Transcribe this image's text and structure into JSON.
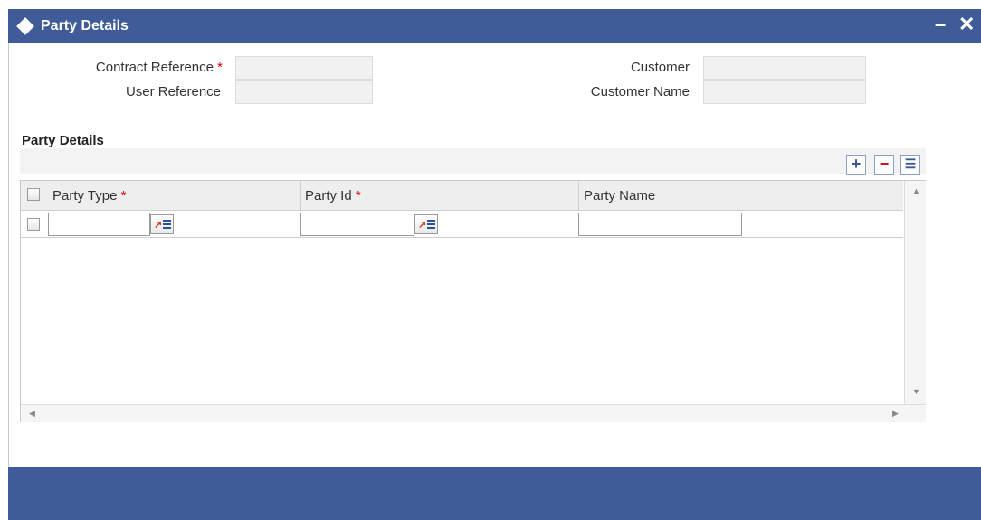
{
  "window": {
    "title": "Party Details",
    "minimize_label": "–",
    "close_label": "✕"
  },
  "header_fields": {
    "contract_reference": {
      "label": "Contract Reference",
      "required_mark": "*",
      "value": ""
    },
    "user_reference": {
      "label": "User Reference",
      "value": ""
    },
    "customer": {
      "label": "Customer",
      "value": ""
    },
    "customer_name": {
      "label": "Customer Name",
      "value": ""
    }
  },
  "section": {
    "title": "Party Details"
  },
  "toolbar": {
    "add_label": "+",
    "delete_label": "−",
    "view_label": "☰"
  },
  "grid": {
    "columns": [
      {
        "label": "Party Type",
        "required_mark": "*"
      },
      {
        "label": "Party Id",
        "required_mark": "*"
      },
      {
        "label": "Party Name",
        "required_mark": ""
      }
    ],
    "rows": [
      {
        "party_type": "",
        "party_id": "",
        "party_name": ""
      }
    ]
  },
  "scroll": {
    "up": "▲",
    "down": "▼",
    "left": "◀",
    "right": "▶"
  },
  "colors": {
    "title_bar": "#3f5c99",
    "footer_bar": "#3f5c99",
    "required": "#dd0000"
  }
}
